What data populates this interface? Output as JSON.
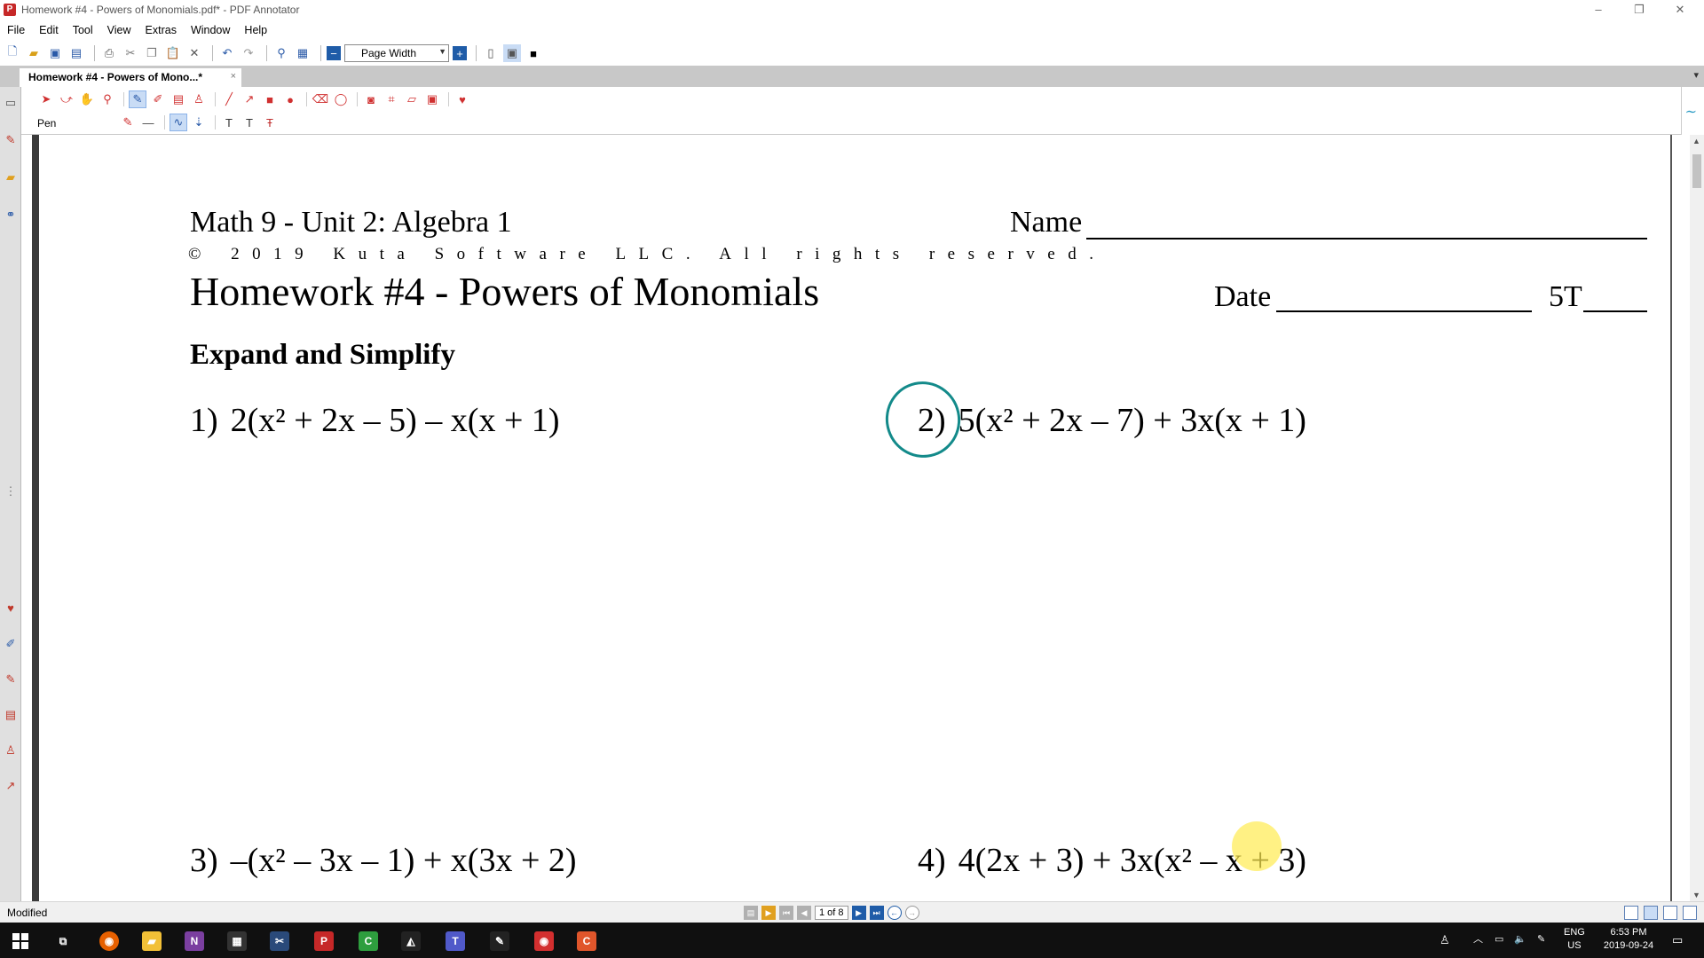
{
  "window": {
    "title": "Homework #4 - Powers of Monomials.pdf* - PDF Annotator",
    "app_icon": "pdf-annotator-icon",
    "minimize": "–",
    "restore": "❐",
    "close": "✕"
  },
  "menu": {
    "items": [
      {
        "label": "File"
      },
      {
        "label": "Edit"
      },
      {
        "label": "Tool"
      },
      {
        "label": "View"
      },
      {
        "label": "Extras"
      },
      {
        "label": "Window"
      },
      {
        "label": "Help"
      }
    ]
  },
  "toolbar": {
    "zoom_value": "Page Width",
    "icons": [
      "new-document-icon",
      "open-folder-icon",
      "save-icon",
      "save-as-icon",
      "print-icon",
      "cut-icon",
      "copy-icon",
      "paste-icon",
      "delete-icon",
      "undo-icon",
      "redo-icon",
      "find-icon",
      "properties-icon",
      "zoom-out-icon",
      "zoom-in-icon",
      "single-page-icon",
      "fit-page-icon",
      "fullscreen-icon"
    ]
  },
  "tabs": {
    "active": "Homework #4 - Powers of Mono...*",
    "close": "×",
    "menu_glyph": "▾"
  },
  "annotation_toolbar": {
    "tool_label": "Pen",
    "icons": [
      "select-icon",
      "select-text-icon",
      "hand-icon",
      "zoom-icon",
      "pen-icon",
      "highlighter-icon",
      "text-box-icon",
      "stamp-icon",
      "line-icon",
      "arrow-icon",
      "rectangle-icon",
      "ellipse-icon",
      "eraser-icon",
      "lasso-icon",
      "snapshot-icon",
      "crop-icon",
      "ruler-icon",
      "insert-image-icon",
      "favorites-icon"
    ]
  },
  "document": {
    "course": "Math 9 - Unit 2: Algebra 1",
    "name_label": "Name",
    "copyright": "© 2019 Kuta Software LLC. All rights reserved.",
    "title": "Homework #4 - Powers of Monomials",
    "date_label": "Date",
    "period_label": "5T",
    "instructions": "Expand and Simplify",
    "problems": [
      {
        "number": "1)",
        "expression": "2(x² + 2x – 5) – x(x + 1)"
      },
      {
        "number": "2)",
        "expression": "5(x² + 2x – 7) + 3x(x + 1)"
      },
      {
        "number": "3)",
        "expression": "–(x² – 3x – 1) + x(3x + 2)"
      },
      {
        "number": "4)",
        "expression": "4(2x + 3) + 3x(x² – x + 3)"
      }
    ]
  },
  "status": {
    "state": "Modified",
    "page_indicator": "1 of 8"
  },
  "taskbar": {
    "language": "ENG",
    "region": "US",
    "time": "6:53 PM",
    "date": "2019-09-24"
  },
  "colors": {
    "ink_circle": "#138a8a",
    "cursor_highlight": "#ffeb50",
    "tool_red": "#d03030",
    "accent_blue": "#1f5ca8"
  }
}
